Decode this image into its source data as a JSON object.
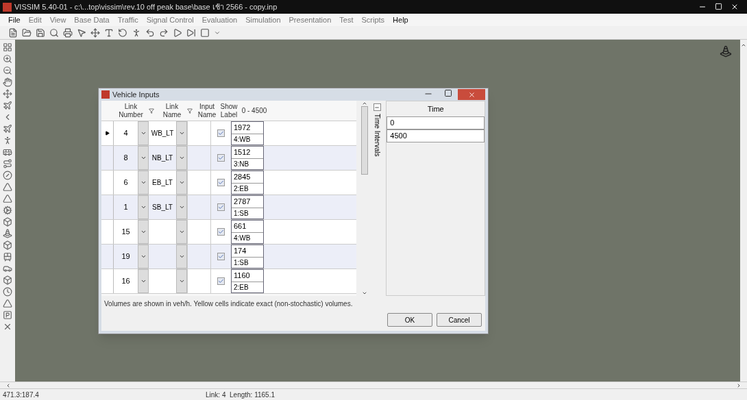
{
  "window": {
    "title": "VISSIM 5.40-01 - c:\\...top\\vissim\\rev.10  off peak base\\base เช้า 2566 - copy.inp"
  },
  "menu": [
    {
      "label": "File",
      "disabled": false
    },
    {
      "label": "Edit",
      "disabled": true
    },
    {
      "label": "View",
      "disabled": true
    },
    {
      "label": "Base Data",
      "disabled": true
    },
    {
      "label": "Traffic",
      "disabled": true
    },
    {
      "label": "Signal Control",
      "disabled": true
    },
    {
      "label": "Evaluation",
      "disabled": true
    },
    {
      "label": "Simulation",
      "disabled": true
    },
    {
      "label": "Presentation",
      "disabled": true
    },
    {
      "label": "Test",
      "disabled": true
    },
    {
      "label": "Scripts",
      "disabled": true
    },
    {
      "label": "Help",
      "disabled": false
    }
  ],
  "dialog": {
    "title": "Vehicle Inputs",
    "columns": [
      "Link Number",
      "Link Name",
      "Input Name",
      "Show Label",
      "0 - 4500"
    ],
    "rows": [
      {
        "link_number": "4",
        "link_name": "WB_LT",
        "show_label": true,
        "volume": "1972",
        "label": "4:WB",
        "current": true
      },
      {
        "link_number": "8",
        "link_name": "NB_LT",
        "show_label": true,
        "volume": "1512",
        "label": "3:NB",
        "current": false
      },
      {
        "link_number": "6",
        "link_name": "EB_LT",
        "show_label": true,
        "volume": "2845",
        "label": "2:EB",
        "current": false
      },
      {
        "link_number": "1",
        "link_name": "SB_LT",
        "show_label": true,
        "volume": "2787",
        "label": "1:SB",
        "current": false
      },
      {
        "link_number": "15",
        "link_name": "",
        "show_label": true,
        "volume": "661",
        "label": "4:WB",
        "current": false
      },
      {
        "link_number": "19",
        "link_name": "",
        "show_label": true,
        "volume": "174",
        "label": "1:SB",
        "current": false
      },
      {
        "link_number": "16",
        "link_name": "",
        "show_label": true,
        "volume": "1160",
        "label": "2:EB",
        "current": false
      }
    ],
    "side_panel_title": "Time Intervals",
    "time_column": "Time",
    "times": [
      "0",
      "4500"
    ],
    "note": "Volumes are shown in veh/h. Yellow cells indicate exact (non-stochastic) volumes.",
    "buttons": [
      "OK",
      "Cancel"
    ]
  },
  "status_bar": {
    "coordinates": "471.3:187.4",
    "link_info": "Link: 4  Length: 1165.1"
  }
}
